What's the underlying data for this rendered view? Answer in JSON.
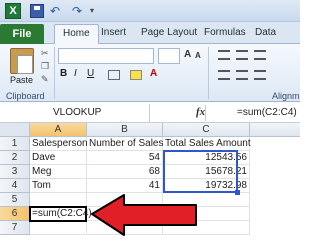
{
  "app": {
    "logo_letter": "X"
  },
  "ribbon_tabs": [
    "File",
    "Home",
    "Insert",
    "Page Layout",
    "Formulas",
    "Data"
  ],
  "ribbon": {
    "paste_label": "Paste",
    "clipboard_label": "Clipboard",
    "alignment_label": "Alignm",
    "format_buttons": [
      "B",
      "I",
      "U"
    ]
  },
  "formula_bar": {
    "name_box": "VLOOKUP",
    "fx_label": "fx",
    "formula": "=sum(C2:C4)"
  },
  "sheet": {
    "columns": [
      "A",
      "B",
      "C"
    ],
    "rows": [
      "1",
      "2",
      "3",
      "4",
      "5",
      "6",
      "7"
    ],
    "cells": {
      "A1": "Salesperson",
      "B1": "Number of Sales",
      "C1": "Total Sales Amount",
      "A2": "Dave",
      "B2": "54",
      "C2": "12543.56",
      "A3": "Meg",
      "B3": "68",
      "C3": "15678.21",
      "A4": "Tom",
      "B4": "41",
      "C4": "19732.98",
      "A6": "=sum(C2:C4)"
    },
    "active_row": "6"
  },
  "colors": {
    "arrow": "#e01f26",
    "range_border": "#3355cc",
    "file_tab": "#2a7a34"
  }
}
